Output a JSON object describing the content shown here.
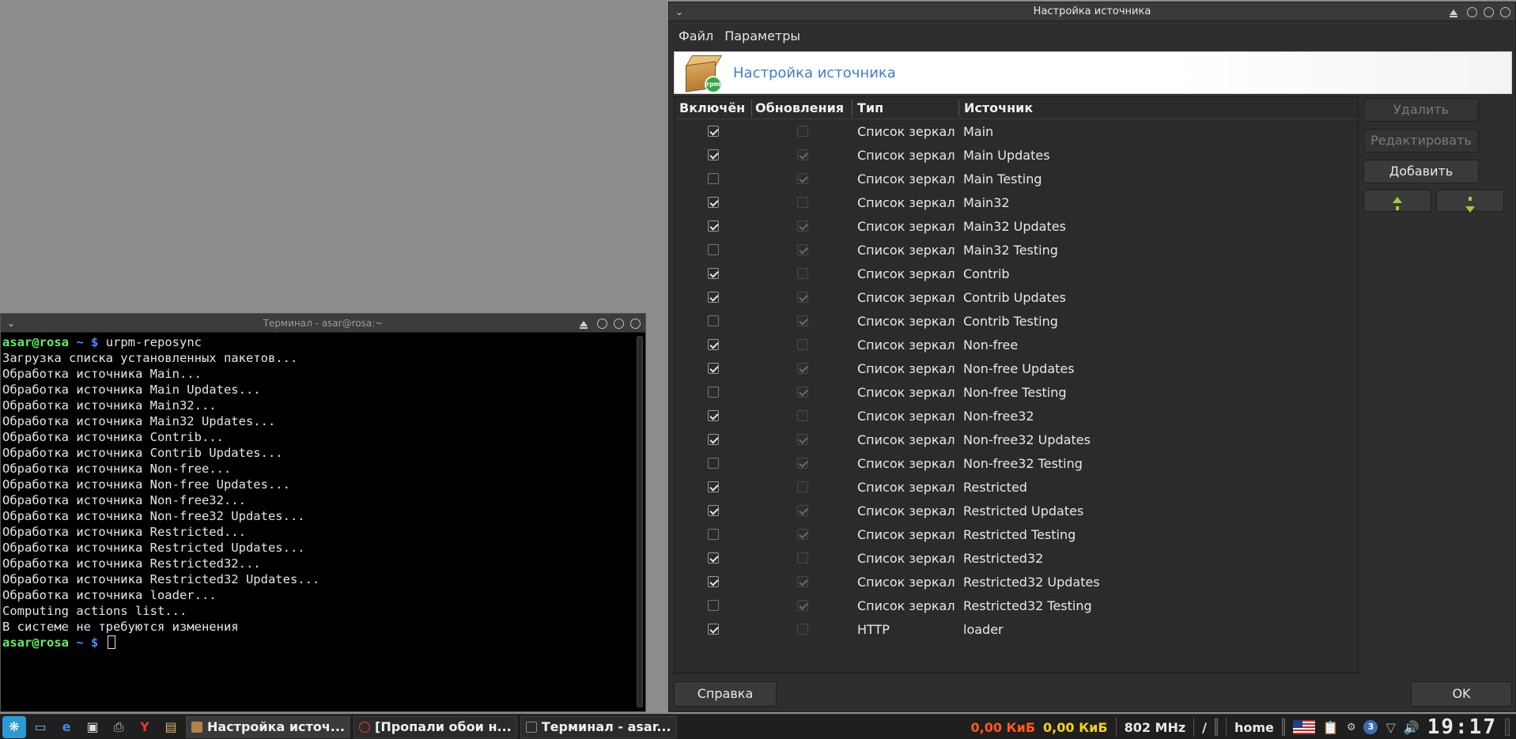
{
  "terminal": {
    "title": "Терминал - asar@rosa:~",
    "prompt_user": "asar@rosa",
    "prompt_symbol": "~ $",
    "command": "urpm-reposync",
    "output": [
      "Загрузка списка установленных пакетов...",
      "Обработка источника Main...",
      "Обработка источника Main Updates...",
      "Обработка источника Main32...",
      "Обработка источника Main32 Updates...",
      "Обработка источника Contrib...",
      "Обработка источника Contrib Updates...",
      "Обработка источника Non-free...",
      "Обработка источника Non-free Updates...",
      "Обработка источника Non-free32...",
      "Обработка источника Non-free32 Updates...",
      "Обработка источника Restricted...",
      "Обработка источника Restricted Updates...",
      "Обработка источника Restricted32...",
      "Обработка источника Restricted32 Updates...",
      "Обработка источника loader...",
      "Computing actions list...",
      "В системе не требуются изменения"
    ]
  },
  "dialog": {
    "title": "Настройка источника",
    "menu": [
      "Файл",
      "Параметры"
    ],
    "banner_title": "Настройка источника",
    "banner_icon_text": "rpm",
    "columns": {
      "enabled": "Включён",
      "updates": "Обновления",
      "type": "Тип",
      "source": "Источник"
    },
    "rows": [
      {
        "enabled": true,
        "updates": false,
        "type": "Список зеркал",
        "source": "Main"
      },
      {
        "enabled": true,
        "updates": true,
        "type": "Список зеркал",
        "source": "Main Updates"
      },
      {
        "enabled": false,
        "updates": true,
        "type": "Список зеркал",
        "source": "Main Testing"
      },
      {
        "enabled": true,
        "updates": false,
        "type": "Список зеркал",
        "source": "Main32"
      },
      {
        "enabled": true,
        "updates": true,
        "type": "Список зеркал",
        "source": "Main32 Updates"
      },
      {
        "enabled": false,
        "updates": true,
        "type": "Список зеркал",
        "source": "Main32 Testing"
      },
      {
        "enabled": true,
        "updates": false,
        "type": "Список зеркал",
        "source": "Contrib"
      },
      {
        "enabled": true,
        "updates": true,
        "type": "Список зеркал",
        "source": "Contrib Updates"
      },
      {
        "enabled": false,
        "updates": true,
        "type": "Список зеркал",
        "source": "Contrib Testing"
      },
      {
        "enabled": true,
        "updates": false,
        "type": "Список зеркал",
        "source": "Non-free"
      },
      {
        "enabled": true,
        "updates": true,
        "type": "Список зеркал",
        "source": "Non-free Updates"
      },
      {
        "enabled": false,
        "updates": true,
        "type": "Список зеркал",
        "source": "Non-free Testing"
      },
      {
        "enabled": true,
        "updates": false,
        "type": "Список зеркал",
        "source": "Non-free32"
      },
      {
        "enabled": true,
        "updates": true,
        "type": "Список зеркал",
        "source": "Non-free32 Updates"
      },
      {
        "enabled": false,
        "updates": true,
        "type": "Список зеркал",
        "source": "Non-free32 Testing"
      },
      {
        "enabled": true,
        "updates": false,
        "type": "Список зеркал",
        "source": "Restricted"
      },
      {
        "enabled": true,
        "updates": true,
        "type": "Список зеркал",
        "source": "Restricted Updates"
      },
      {
        "enabled": false,
        "updates": true,
        "type": "Список зеркал",
        "source": "Restricted Testing"
      },
      {
        "enabled": true,
        "updates": false,
        "type": "Список зеркал",
        "source": "Restricted32"
      },
      {
        "enabled": true,
        "updates": true,
        "type": "Список зеркал",
        "source": "Restricted32 Updates"
      },
      {
        "enabled": false,
        "updates": true,
        "type": "Список зеркал",
        "source": "Restricted32 Testing"
      },
      {
        "enabled": true,
        "updates": false,
        "type": "HTTP",
        "source": "loader"
      }
    ],
    "buttons": {
      "delete": "Удалить",
      "edit": "Редактировать",
      "add": "Добавить",
      "help": "Справка",
      "ok": "OK"
    }
  },
  "taskbar": {
    "launchers": [
      "rosa-menu-icon",
      "desktop-icon",
      "browser-icon",
      "terminal-icon",
      "printer-icon",
      "yandex-icon",
      "files-icon"
    ],
    "tasks": [
      {
        "label": "Настройка источ...",
        "icon": "package-icon",
        "active": true
      },
      {
        "label": "[Пропали обои н...",
        "icon": "yandex-icon",
        "active": false
      },
      {
        "label": "Терминал - asar...",
        "icon": "terminal-icon",
        "active": false
      }
    ],
    "tray": {
      "net_down": "0,00 КиБ",
      "net_up": "0,00 КиБ",
      "cpu": "802 MHz",
      "fs_root": "/",
      "fs_home": "home",
      "notification_count": "3",
      "clock": "19:17"
    },
    "colors": {
      "net_down": "#ff5a1a",
      "net_up": "#f2d21a"
    }
  }
}
